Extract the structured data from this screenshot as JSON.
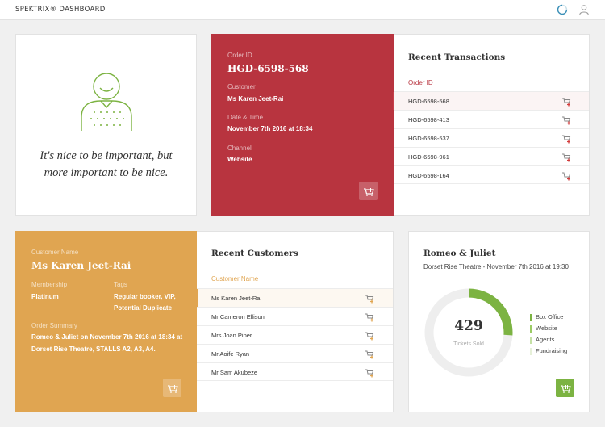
{
  "header": {
    "brand": "SPEKTRIX® DASHBOARD"
  },
  "quote": {
    "line1": "It's nice to be important, but",
    "line2": "more important to be nice."
  },
  "order": {
    "order_id_label": "Order ID",
    "order_id": "HGD-6598-568",
    "customer_label": "Customer",
    "customer": "Ms Karen Jeet-Rai",
    "datetime_label": "Date & Time",
    "datetime": "November 7th 2016 at 18:34",
    "channel_label": "Channel",
    "channel": "Website"
  },
  "transactions": {
    "title": "Recent Transactions",
    "column": "Order ID",
    "rows": [
      "HGD-6598-568",
      "HGD-6598-413",
      "HGD-6598-537",
      "HGD-6598-961",
      "HGD-6598-164"
    ]
  },
  "customer": {
    "name_label": "Customer Name",
    "name": "Ms Karen Jeet-Rai",
    "membership_label": "Membership",
    "membership": "Platinum",
    "tags_label": "Tags",
    "tags_line1": "Regular booker, VIP,",
    "tags_line2": "Potential Duplicate",
    "summary_label": "Order Summary",
    "summary_line1": "Romeo & Juliet on November 7th 2016 at 18:34 at",
    "summary_line2": "Dorset Rise Theatre, STALLS A2, A3, A4."
  },
  "customers": {
    "title": "Recent Customers",
    "column": "Customer Name",
    "rows": [
      "Ms Karen Jeet-Rai",
      "Mr Cameron Ellison",
      "Mrs Joan Piper",
      "Mr Aoife Ryan",
      "Mr Sam Akubeze"
    ]
  },
  "show": {
    "title": "Romeo & Juliet",
    "subtitle": "Dorset Rise Theatre - November 7th 2016 at 19:30",
    "tickets_sold": "429",
    "tickets_label": "Tickets Sold",
    "donut_fraction": 0.26,
    "legend": [
      {
        "label": "Box Office",
        "color": "#7cb342"
      },
      {
        "label": "Website",
        "color": "#9ccc65"
      },
      {
        "label": "Agents",
        "color": "#c5e1a5"
      },
      {
        "label": "Fundraising",
        "color": "#e6f0d8"
      }
    ]
  },
  "colors": {
    "order_red": "#b8343f",
    "customer_orange": "#e0a551",
    "show_green": "#7cb342"
  },
  "icons": {
    "refresh": "refresh-icon",
    "user": "user-icon",
    "basket": "basket-icon",
    "basket_add": "basket-add-icon"
  }
}
